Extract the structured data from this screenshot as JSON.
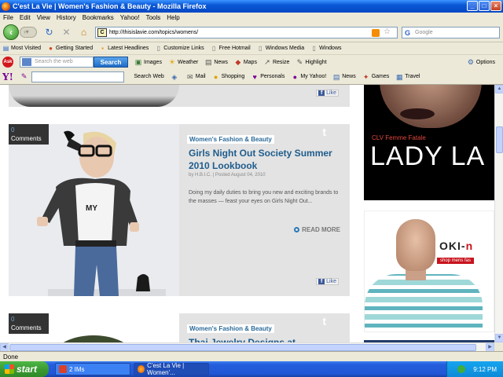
{
  "window": {
    "title": "C'est La Vie | Women's Fashion & Beauty - Mozilla Firefox"
  },
  "menu": [
    "File",
    "Edit",
    "View",
    "History",
    "Bookmarks",
    "Yahoo!",
    "Tools",
    "Help"
  ],
  "nav": {
    "url": "http://thisislavie.com/topics/womens/",
    "favicon_text": "C",
    "search_placeholder": "Google"
  },
  "bookmarks": [
    "Most Visited",
    "Getting Started",
    "Latest Headlines",
    "Customize Links",
    "Free Hotmail",
    "Windows Media",
    "Windows"
  ],
  "ask_toolbar": {
    "logo": "Ask",
    "search_placeholder": "Search the web",
    "search_button": "Search",
    "items": [
      "Images",
      "Weather",
      "News",
      "Maps",
      "Resize",
      "Highlight"
    ],
    "options": "Options"
  },
  "yahoo_toolbar": {
    "logo": "Y!",
    "search_web": "Search Web",
    "items": [
      "Mail",
      "Shopping",
      "Personals",
      "My Yahoo!",
      "News",
      "Games",
      "Travel"
    ]
  },
  "posts": [
    {
      "like": "Like"
    },
    {
      "comments_count": "0",
      "comments_label": "Comments",
      "category": "Women's Fashion & Beauty",
      "title": "Girls Night Out Society Summer 2010 Lookbook",
      "byline": "by H.B.I.C.   |   Posted August 04, 2010",
      "excerpt": "Doing my daily duties to bring you new and exciting brands to the masses — feast your eyes on Girls Night Out...",
      "read_more": "READ MORE",
      "like": "Like"
    },
    {
      "comments_count": "0",
      "comments_label": "Comments",
      "category": "Women's Fashion & Beauty",
      "title": "Thai Jewelry Designs at"
    }
  ],
  "ads": {
    "ad1_sub": "CLV Femme Fatale",
    "ad1_big": "LADY LA",
    "ad2_logo_a": "OKI-",
    "ad2_logo_b": "n",
    "ad2_shop": "shop mens fas"
  },
  "status": "Done",
  "taskbar": {
    "start": "start",
    "items": [
      "2 IMs",
      "C'est La Vie | Women'..."
    ],
    "clock": "9:12 PM"
  }
}
